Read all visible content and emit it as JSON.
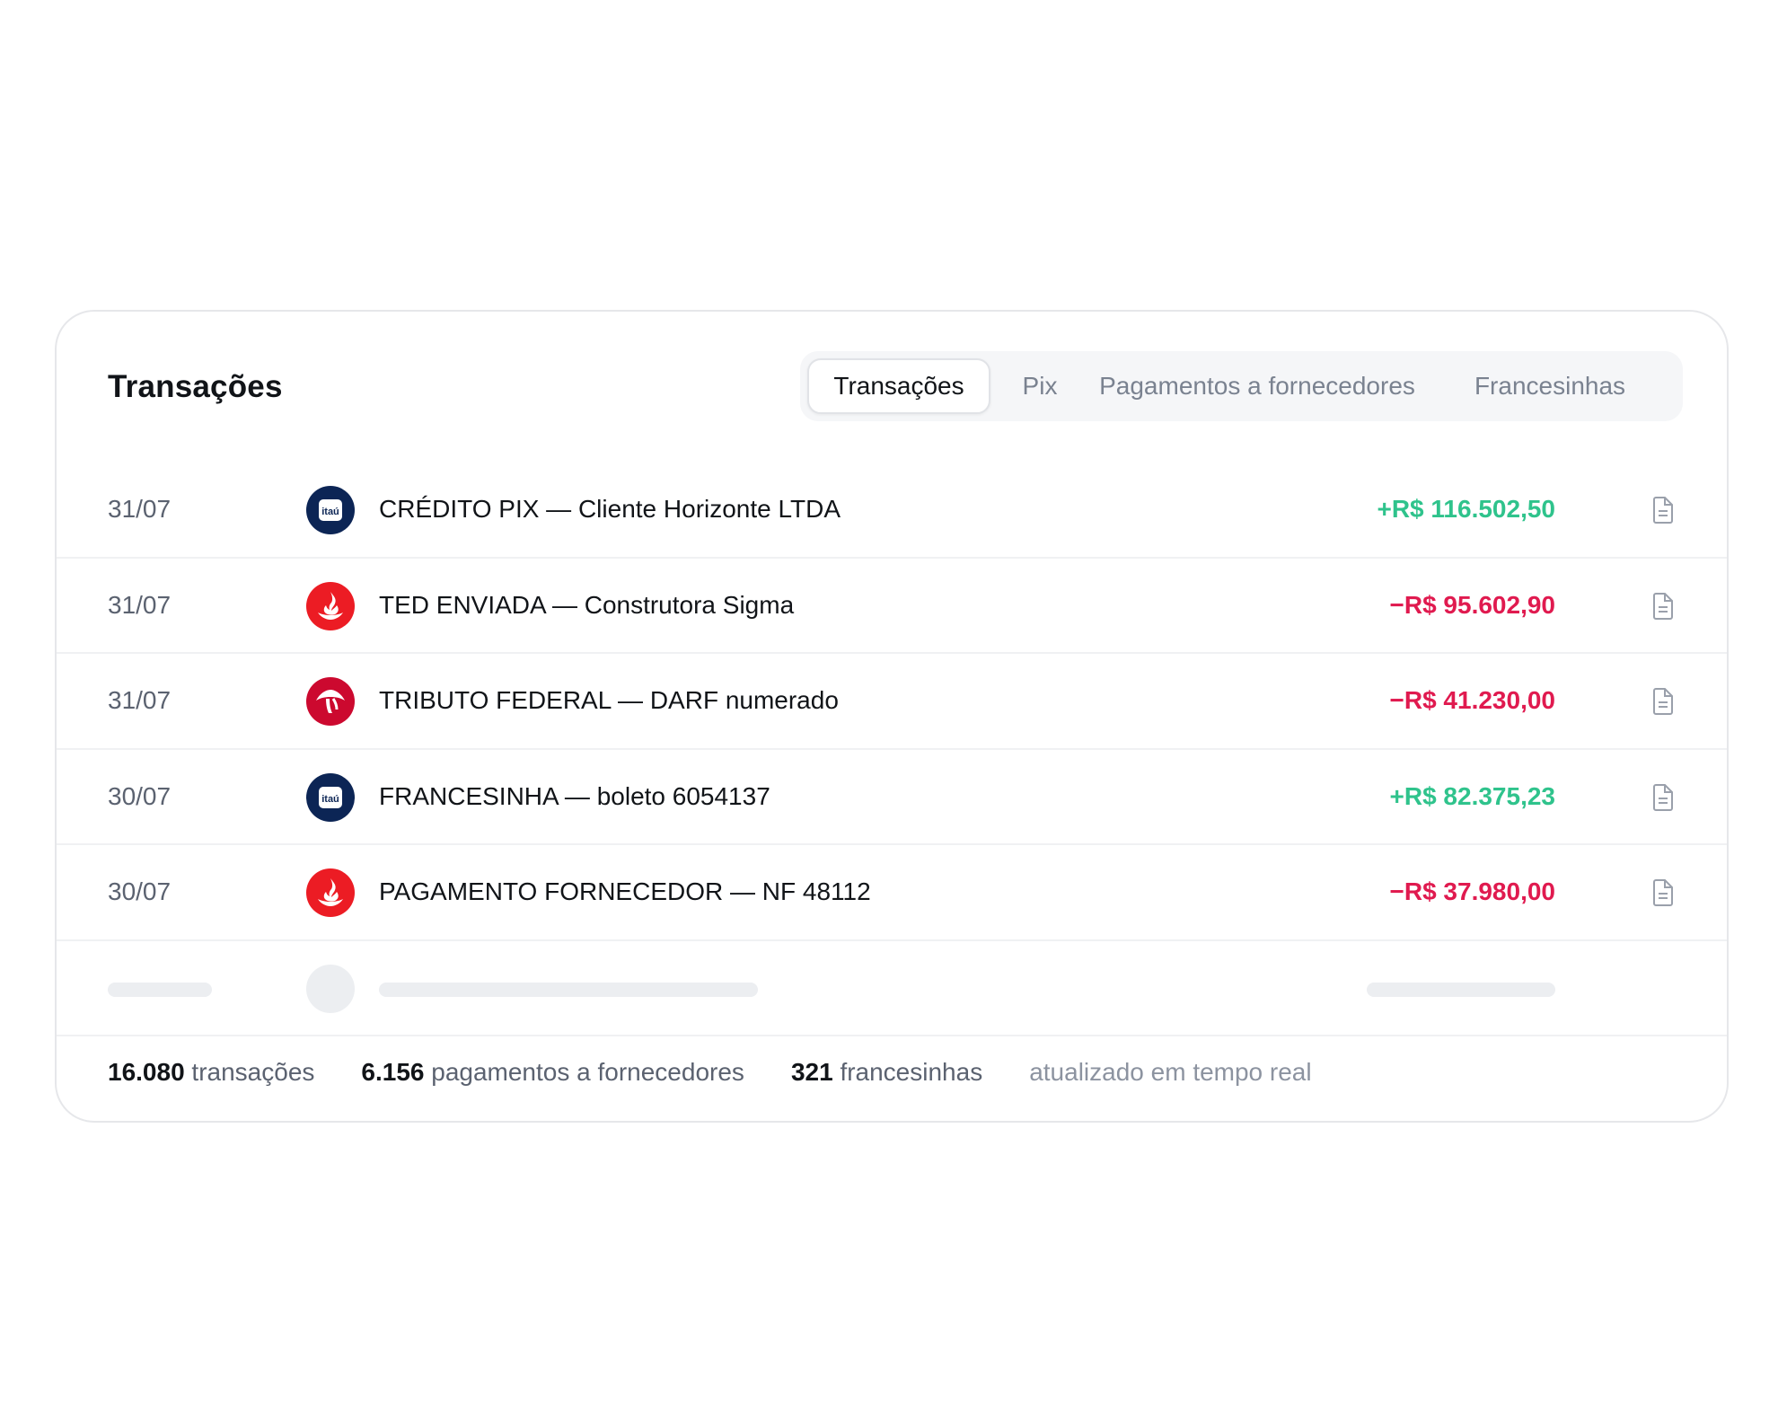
{
  "header": {
    "title": "Transações"
  },
  "tabs": [
    {
      "label": "Transações",
      "active": true
    },
    {
      "label": "Pix",
      "active": false
    },
    {
      "label": "Pagamentos a fornecedores",
      "active": false
    },
    {
      "label": "Francesinhas",
      "active": false
    }
  ],
  "transactions": [
    {
      "date": "31/07",
      "bank_icon": "itau-logo-icon",
      "logo_text": "itaú",
      "description": "CRÉDITO PIX — Cliente Horizonte LTDA",
      "amount": "+R$ 116.502,50",
      "kind": "credit"
    },
    {
      "date": "31/07",
      "bank_icon": "santander-logo-icon",
      "description": "TED ENVIADA — Construtora Sigma",
      "amount": "−R$ 95.602,90",
      "kind": "debit"
    },
    {
      "date": "31/07",
      "bank_icon": "bradesco-logo-icon",
      "description": "TRIBUTO FEDERAL — DARF numerado",
      "amount": "−R$ 41.230,00",
      "kind": "debit"
    },
    {
      "date": "30/07",
      "bank_icon": "itau-logo-icon",
      "logo_text": "itaú",
      "description": "FRANCESINHA — boleto 6054137",
      "amount": "+R$ 82.375,23",
      "kind": "credit"
    },
    {
      "date": "30/07",
      "bank_icon": "santander-logo-icon",
      "description": "PAGAMENTO FORNECEDOR — NF 48112",
      "amount": "−R$ 37.980,00",
      "kind": "debit"
    }
  ],
  "footer": {
    "transactions_count": "16.080",
    "transactions_label": "transações",
    "suppliers_count": "6.156",
    "suppliers_label": "pagamentos a fornecedores",
    "francesinhas_count": "321",
    "francesinhas_label": "francesinhas",
    "realtime_note": "atualizado em tempo real"
  },
  "colors": {
    "credit": "#2fc38c",
    "debit": "#e01a4f",
    "itau": "#0c2555",
    "santander": "#ec1c24",
    "bradesco": "#cc092f"
  }
}
